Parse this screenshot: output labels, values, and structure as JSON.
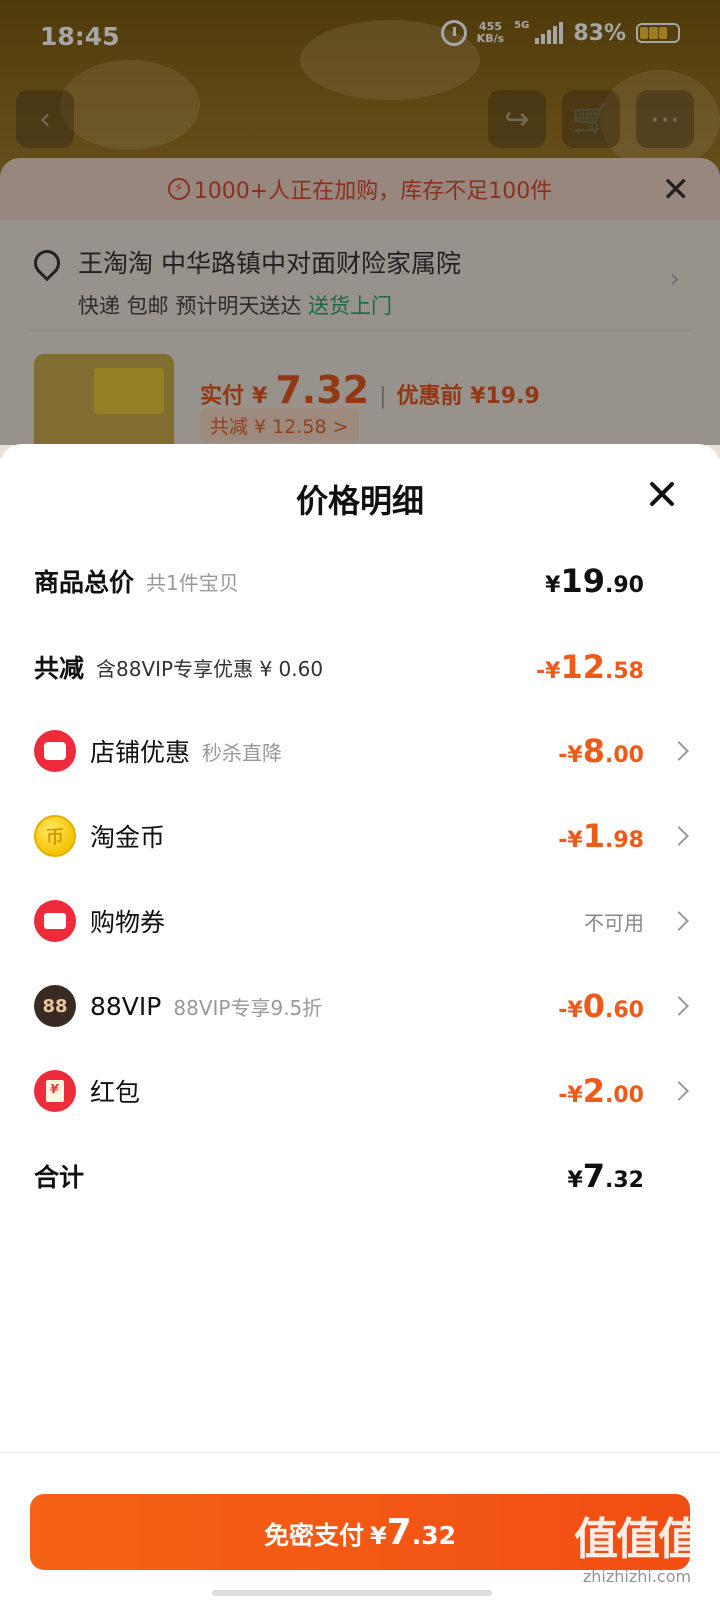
{
  "status_bar": {
    "time": "18:45",
    "net_speed": "455",
    "net_unit": "KB/s",
    "network": "5G",
    "battery": "83%"
  },
  "background": {
    "alert": "1000+人正在加购，库存不足100件",
    "address_name": "王淘淘 中华路镇中对面财险家属院",
    "shipping": "快递 包邮 预计明天送达",
    "shipping_highlight": "送货上门",
    "pay_label": "实付",
    "pay_currency": "¥",
    "pay_amount": "7.32",
    "orig_label": "优惠前 ¥19.9",
    "saving_chip": "共减 ¥ 12.58 >"
  },
  "panel": {
    "title": "价格明细",
    "rows": [
      {
        "label": "商品总价",
        "sub": "共1件宝贝",
        "cur": "¥",
        "int": "19",
        "dec": ".90"
      },
      {
        "label": "共减",
        "sub": "含88VIP专享优惠 ¥ 0.60",
        "cur": "-¥",
        "int": "12",
        "dec": ".58"
      },
      {
        "label": "店铺优惠",
        "sub": "秒杀直降",
        "cur": "-¥",
        "int": "8",
        "dec": ".00",
        "icon": "shop-icon"
      },
      {
        "label": "淘金币",
        "sub": "",
        "cur": "-¥",
        "int": "1",
        "dec": ".98",
        "icon": "gold-coin-icon"
      },
      {
        "label": "购物券",
        "sub": "",
        "value": "不可用",
        "icon": "coupon-icon"
      },
      {
        "label": "88VIP",
        "sub": "88VIP专享9.5折",
        "cur": "-¥",
        "int": "0",
        "dec": ".60",
        "icon": "vip-icon",
        "icon_text": "88"
      },
      {
        "label": "红包",
        "sub": "",
        "cur": "-¥",
        "int": "2",
        "dec": ".00",
        "icon": "red-packet-icon"
      },
      {
        "label": "合计",
        "sub": "",
        "cur": "¥",
        "int": "7",
        "dec": ".32"
      }
    ],
    "pay_button": {
      "text": "免密支付",
      "cur": "¥",
      "int": "7",
      "dec": ".32"
    }
  },
  "watermark": {
    "logo": "值值值",
    "url": "zhizhizhi.com"
  },
  "colors": {
    "accent": "#ee5a19",
    "button": "#f14d12",
    "red_icon": "#ee2b3b"
  }
}
